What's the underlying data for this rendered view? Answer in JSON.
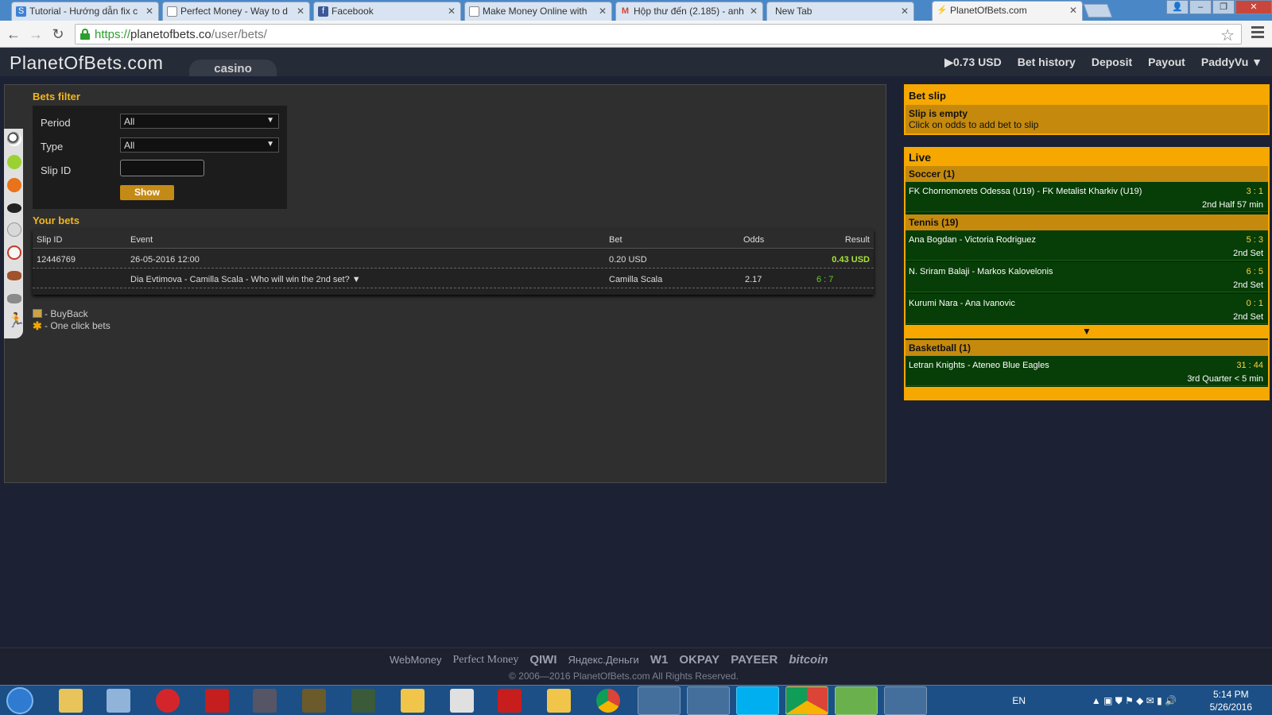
{
  "browser": {
    "tabs": [
      {
        "title": "Tutorial - Hướng dẫn fix c",
        "active": false
      },
      {
        "title": "Perfect Money - Way to d",
        "active": false
      },
      {
        "title": "Facebook",
        "active": false
      },
      {
        "title": "Make Money Online with",
        "active": false
      },
      {
        "title": "Hộp thư đến (2.185) - anh",
        "active": false
      },
      {
        "title": "New Tab",
        "active": false
      },
      {
        "title": "PlanetOfBets.com",
        "active": true
      }
    ],
    "url_scheme": "https://",
    "url_host": "planetofbets.co",
    "url_path": "/user/bets/"
  },
  "header": {
    "logo": "PlanetOfBets.com",
    "section_tab": "casino",
    "nav": {
      "balance": "▶0.73 USD",
      "bet_history": "Bet history",
      "deposit": "Deposit",
      "payout": "Payout",
      "user": "PaddyVu ▼"
    }
  },
  "filter": {
    "title": "Bets filter",
    "period_label": "Period",
    "period_value": "All",
    "type_label": "Type",
    "type_value": "All",
    "slip_label": "Slip ID",
    "slip_value": "",
    "show_label": "Show"
  },
  "bets": {
    "title": "Your bets",
    "columns": {
      "slip": "Slip ID",
      "event": "Event",
      "bet": "Bet",
      "odds": "Odds",
      "result": "Result"
    },
    "slip_row": {
      "slip": "12446769",
      "event": "26-05-2016 12:00",
      "bet": "0.20 USD",
      "result": "0.43 USD"
    },
    "detail_row": {
      "event": "Dia Evtimova - Camilla Scala - Who will win the 2nd set? ▼",
      "bet": "Camilla Scala",
      "odds": "2.17",
      "score": "6 : 7"
    }
  },
  "legend": {
    "buyback": "- BuyBack",
    "oneclick": "- One click bets"
  },
  "betslip": {
    "title": "Bet slip",
    "empty": "Slip is empty",
    "hint": "Click on odds to add bet to slip"
  },
  "live": {
    "title": "Live",
    "soccer": {
      "header": "Soccer (1)",
      "matches": [
        {
          "teams": "FK Chornomorets Odessa (U19) - FK Metalist Kharkiv (U19)",
          "score": "3 : 1",
          "status": "2nd Half  57 min"
        }
      ]
    },
    "tennis": {
      "header": "Tennis (19)",
      "matches": [
        {
          "teams": "Ana Bogdan - Victoria Rodriguez",
          "score": "5 : 3",
          "status": "2nd Set"
        },
        {
          "teams": "N. Sriram Balaji - Markos Kalovelonis",
          "score": "6 : 5",
          "status": "2nd Set"
        },
        {
          "teams": "Kurumi Nara - Ana Ivanovic",
          "score": "0 : 1",
          "status": "2nd Set"
        }
      ]
    },
    "expand": "▼",
    "basketball": {
      "header": "Basketball (1)",
      "matches": [
        {
          "teams": "Letran Knights - Ateneo Blue Eagles",
          "score": "31 : 44",
          "status": "3rd Quarter  < 5 min"
        }
      ]
    }
  },
  "footer": {
    "payments": [
      "WebMoney",
      "Perfect Money",
      "QIWI",
      "Яндекс.Деньги",
      "W1",
      "OKPAY",
      "PAYEER",
      "bitcoin"
    ],
    "copyright": "© 2006—2016 PlanetOfBets.com All Rights Reserved."
  },
  "taskbar": {
    "lang": "EN",
    "time": "5:14 PM",
    "date": "5/26/2016"
  },
  "colors": {
    "accent": "#f6a800",
    "live_bg": "#073d07",
    "result_green": "#a7e33c"
  }
}
